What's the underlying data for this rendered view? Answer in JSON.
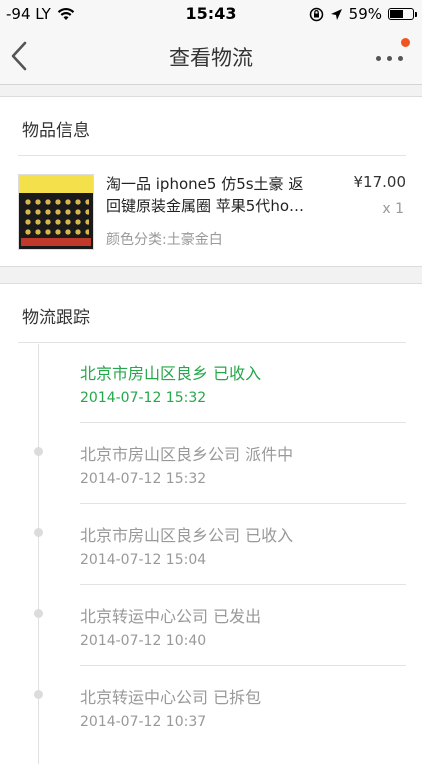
{
  "status_bar": {
    "carrier": "-94 LY",
    "time": "15:43",
    "battery": "59%"
  },
  "nav": {
    "title": "查看物流"
  },
  "goods_section": {
    "title": "物品信息",
    "product": {
      "name_line1": "淘一品 iphone5 仿5s土豪 返",
      "name_line2": "回键原装金属圈 苹果5代ho…",
      "price": "¥17.00",
      "quantity": "x 1",
      "spec": "颜色分类:土豪金白"
    }
  },
  "tracking_section": {
    "title": "物流跟踪",
    "events": [
      {
        "text": "北京市房山区良乡 已收入",
        "time": "2014-07-12 15:32",
        "active": true
      },
      {
        "text": "北京市房山区良乡公司 派件中",
        "time": "2014-07-12 15:32",
        "active": false
      },
      {
        "text": "北京市房山区良乡公司 已收入",
        "time": "2014-07-12 15:04",
        "active": false
      },
      {
        "text": "北京转运中心公司 已发出",
        "time": "2014-07-12 10:40",
        "active": false
      },
      {
        "text": "北京转运中心公司 已拆包",
        "time": "2014-07-12 10:37",
        "active": false
      }
    ]
  },
  "icons": {
    "back": "chevron-left-icon",
    "more": "more-dots-icon",
    "wifi": "wifi-icon",
    "location": "location-arrow-icon",
    "rotation_lock": "rotation-lock-icon",
    "battery": "battery-icon"
  },
  "colors": {
    "active_green": "#24a84a",
    "notification_red": "#f2541e"
  }
}
